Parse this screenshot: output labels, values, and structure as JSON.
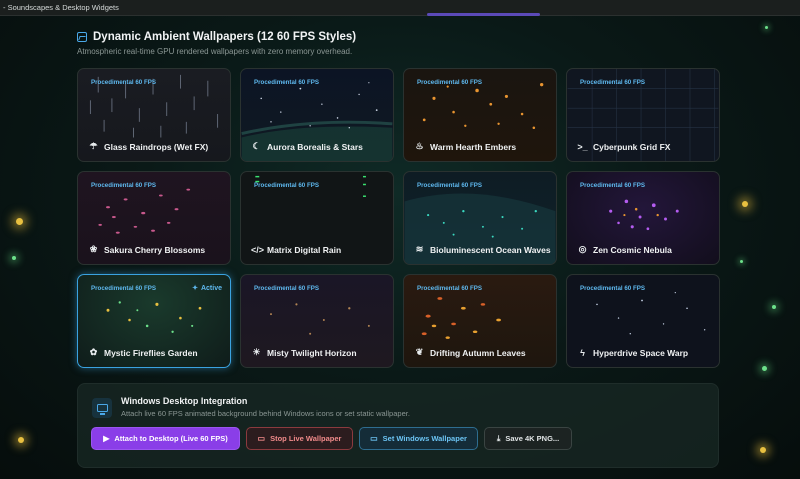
{
  "window": {
    "title": "- Soundscapes & Desktop Widgets"
  },
  "header": {
    "icon": "image-icon",
    "title": "Dynamic Ambient Wallpapers (12 60 FPS Styles)",
    "subtitle": "Atmospheric real-time GPU rendered wallpapers with zero memory overhead."
  },
  "wallpapers": [
    {
      "badge": "Procedimental 60 FPS",
      "label": "Glass Raindrops (Wet FX)",
      "icon": "cloud-rain-icon",
      "glyph": "☂"
    },
    {
      "badge": "Procedimental 60 FPS",
      "label": "Aurora Borealis & Stars",
      "icon": "moon-icon",
      "glyph": "☾"
    },
    {
      "badge": "Procedimental 60 FPS",
      "label": "Warm Hearth Embers",
      "icon": "flame-icon",
      "glyph": "♨"
    },
    {
      "badge": "Procedimental 60 FPS",
      "label": "Cyberpunk Grid FX",
      "icon": "terminal-icon",
      "glyph": ">_"
    },
    {
      "badge": "Procedimental 60 FPS",
      "label": "Sakura Cherry Blossoms",
      "icon": "flower-icon",
      "glyph": "❀"
    },
    {
      "badge": "Procedimental 60 FPS",
      "label": "Matrix Digital Rain",
      "icon": "code-icon",
      "glyph": "</>"
    },
    {
      "badge": "Procedimental 60 FPS",
      "label": "Bioluminescent Ocean Waves",
      "icon": "waves-icon",
      "glyph": "≋"
    },
    {
      "badge": "Procedimental 60 FPS",
      "label": "Zen Cosmic Nebula",
      "icon": "compass-icon",
      "glyph": "◎"
    },
    {
      "badge": "Procedimental 60 FPS",
      "label": "Mystic Fireflies Garden",
      "icon": "bug-icon",
      "glyph": "✿",
      "active": "Active"
    },
    {
      "badge": "Procedimental 60 FPS",
      "label": "Misty Twilight Horizon",
      "icon": "sun-icon",
      "glyph": "☀"
    },
    {
      "badge": "Procedimental 60 FPS",
      "label": "Drifting Autumn Leaves",
      "icon": "leaf-icon",
      "glyph": "❦"
    },
    {
      "badge": "Procedimental 60 FPS",
      "label": "Hyperdrive Space Warp",
      "icon": "zap-icon",
      "glyph": "ϟ"
    }
  ],
  "integration": {
    "title": "Windows Desktop Integration",
    "subtitle": "Attach live 60 FPS animated background behind Windows icons or set static wallpaper.",
    "buttons": {
      "attach": "Attach to Desktop (Live 60 FPS)",
      "stop": "Stop Live Wallpaper",
      "set": "Set Windows Wallpaper",
      "save": "Save 4K PNG..."
    }
  },
  "colors": {
    "accent_blue": "#5eb8ee",
    "accent_purple": "#8a3ee8",
    "danger": "#f08a8a"
  }
}
